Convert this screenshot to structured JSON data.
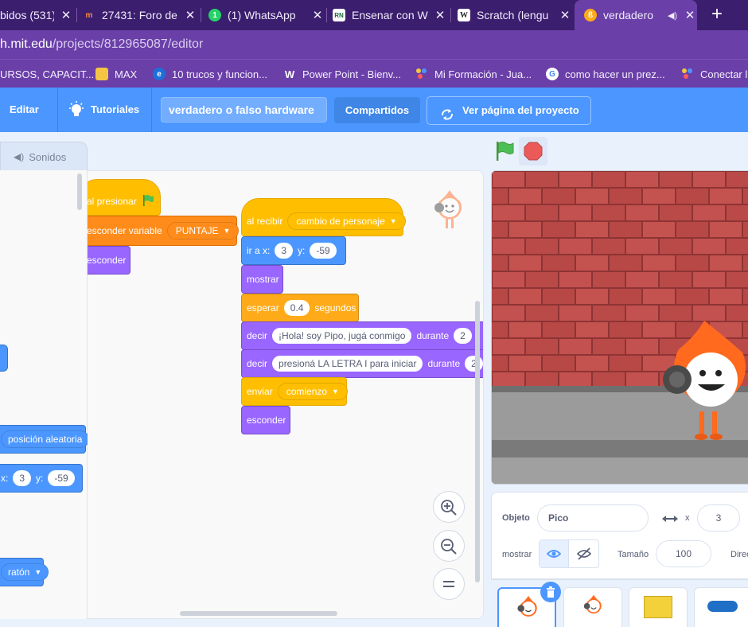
{
  "browser": {
    "tabs": [
      {
        "title": "bidos (531)",
        "icon_label": ""
      },
      {
        "title": "27431: Foro de",
        "icon_label": "m"
      },
      {
        "title": "(1) WhatsApp",
        "icon_label": "1"
      },
      {
        "title": "Ensenar con W",
        "icon_label": "RN"
      },
      {
        "title": "Scratch (lengu",
        "icon_label": "W"
      },
      {
        "title": "verdadero",
        "icon_label": ""
      }
    ],
    "active_tab_index": 5,
    "url_host": "h.mit.edu",
    "url_path": "/projects/812965087/editor",
    "bookmarks": [
      {
        "label": "URSOS, CAPACIT..."
      },
      {
        "label": "MAX"
      },
      {
        "label": "10 trucos y funcion..."
      },
      {
        "label": "Power Point - Bienv..."
      },
      {
        "label": "Mi Formación - Jua..."
      },
      {
        "label": "como hacer un prez..."
      },
      {
        "label": "Conectar l"
      }
    ]
  },
  "menubar": {
    "edit": "Editar",
    "tutorials": "Tutoriales",
    "project_title": "verdadero o falso hardware",
    "shared": "Compartidos",
    "see_project": "Ver página del proyecto"
  },
  "editor": {
    "sounds_tab": "Sonidos",
    "palette": {
      "random_position": "posición aleatoria",
      "x_label": "x:",
      "x_value": "3",
      "y_label": "y:",
      "y_value": "-59",
      "mouse": "ratón"
    },
    "script1": {
      "when_flag": "al presionar",
      "hide_variable": "esconder variable",
      "variable": "PUNTAJE",
      "hide": "esconder"
    },
    "script2": {
      "when_receive": "al recibir",
      "message": "cambio de personaje",
      "goto_label": "ir a x:",
      "goto_x": "3",
      "goto_y_label": "y:",
      "goto_y": "-59",
      "show": "mostrar",
      "wait": "esperar",
      "wait_value": "0.4",
      "seconds": "segundos",
      "say1": "decir",
      "say1_text": "¡Hola! soy Pipo, jugá conmigo",
      "during1": "durante",
      "during1_value": "2",
      "say2": "decir",
      "say2_text": "presioná LA LETRA  I para iniciar",
      "during2": "durante",
      "during2_value": "2",
      "broadcast": "enviar",
      "broadcast_message": "comienzo",
      "hide": "esconder"
    }
  },
  "sprite_info": {
    "sprite_label": "Objeto",
    "sprite_name": "Pico",
    "x_label": "x",
    "x_value": "3",
    "show_label": "mostrar",
    "size_label": "Tamaño",
    "size_value": "100",
    "direction_label": "Direc"
  },
  "colors": {
    "browser_tabbar": "#3b1e6e",
    "browser_toolbar": "#6a3fa8",
    "scratch_blue": "#4c97ff",
    "events": "#ffbf00",
    "variables": "#ff8c1a",
    "looks": "#9966ff",
    "motion": "#4c97ff",
    "control": "#ffab19"
  }
}
